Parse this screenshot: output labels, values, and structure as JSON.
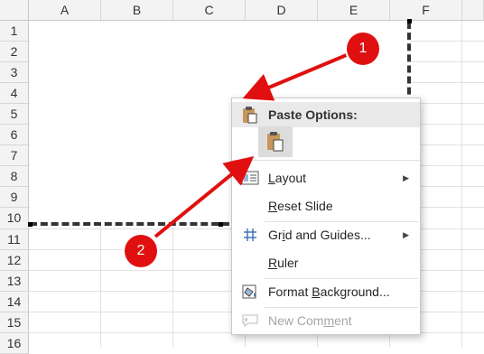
{
  "columns": [
    "A",
    "B",
    "C",
    "D",
    "E",
    "F"
  ],
  "rows": [
    "1",
    "2",
    "3",
    "4",
    "5",
    "6",
    "7",
    "8",
    "9",
    "10",
    "11",
    "12",
    "13",
    "14",
    "15",
    "16"
  ],
  "menu": {
    "paste_options_label": "Paste Options:",
    "items": [
      {
        "label": "Layout",
        "accel_prefix": "",
        "accel": "L",
        "accel_suffix": "ayout",
        "has_submenu": true,
        "icon": "layout-icon"
      },
      {
        "label": "Reset Slide",
        "accel_prefix": "",
        "accel": "R",
        "accel_suffix": "eset Slide",
        "has_submenu": false,
        "icon": ""
      },
      {
        "label": "Grid and Guides...",
        "accel_prefix": "Gr",
        "accel": "i",
        "accel_suffix": "d and Guides...",
        "has_submenu": true,
        "icon": "grid-icon"
      },
      {
        "label": "Ruler",
        "accel_prefix": "",
        "accel": "R",
        "accel_suffix": "uler",
        "has_submenu": false,
        "icon": ""
      },
      {
        "label": "Format Background...",
        "accel_prefix": "Format ",
        "accel": "B",
        "accel_suffix": "ackground...",
        "has_submenu": false,
        "icon": "format-background-icon"
      },
      {
        "label": "New Comment",
        "accel_prefix": "New Com",
        "accel": "m",
        "accel_suffix": "ent",
        "has_submenu": false,
        "icon": "comment-icon",
        "disabled": true
      }
    ]
  },
  "callouts": [
    "1",
    "2"
  ],
  "colors": {
    "callout": "#e01010",
    "arrow": "#e01010"
  }
}
